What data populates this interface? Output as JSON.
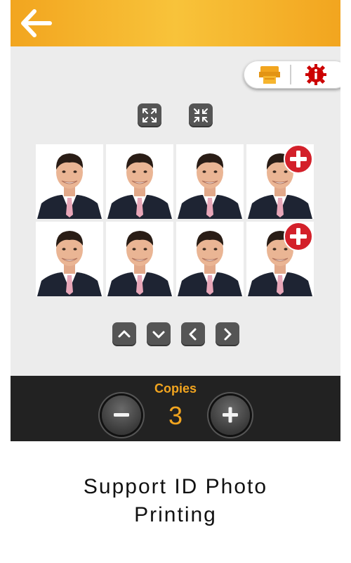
{
  "header": {
    "back_icon": "arrow-left-icon",
    "accent_color": "#f2a51f"
  },
  "toolbar": {
    "print_icon": "printer-icon",
    "info_icon": "info-gear-icon",
    "info_color": "#cc0000"
  },
  "layout_controls": {
    "expand_icon": "expand-arrows-icon",
    "compress_icon": "compress-arrows-icon"
  },
  "photo_grid": {
    "rows": 2,
    "columns": 4,
    "photo_count": 8,
    "add_badge_icon": "add-circle-icon",
    "add_badge_color": "#d3202a"
  },
  "nav_controls": [
    "chevron-up-icon",
    "chevron-down-icon",
    "chevron-left-icon",
    "chevron-right-icon"
  ],
  "copies": {
    "label": "Copies",
    "value": "3",
    "decrement_icon": "minus-icon",
    "increment_icon": "plus-icon"
  },
  "caption": {
    "line1": "Support ID Photo",
    "line2": "Printing"
  }
}
